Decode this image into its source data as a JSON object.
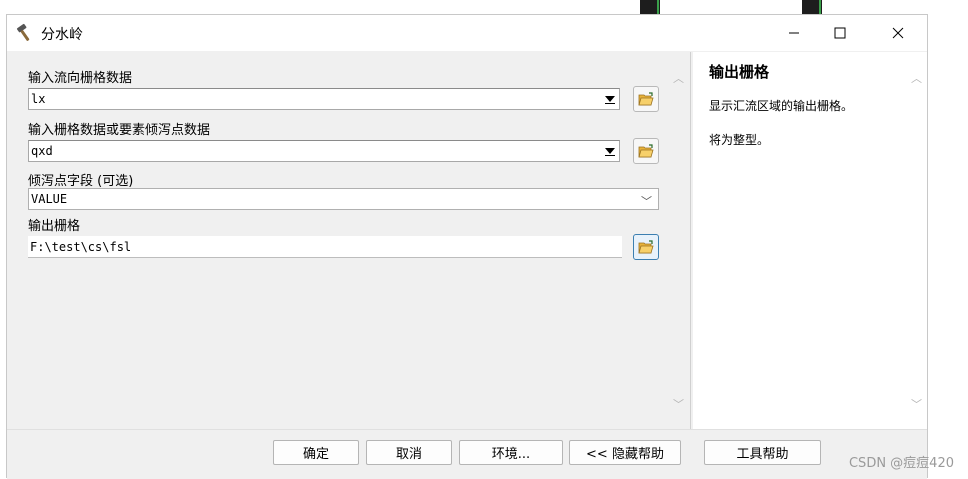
{
  "window": {
    "title": "分水岭"
  },
  "fields": [
    {
      "label": "输入流向栅格数据",
      "value": "lx"
    },
    {
      "label": "输入栅格数据或要素倾泻点数据",
      "value": "qxd"
    },
    {
      "label": "倾泻点字段 (可选)",
      "value": "VALUE"
    },
    {
      "label": "输出栅格",
      "value": "F:\\test\\cs\\fsl"
    }
  ],
  "help": {
    "title": "输出栅格",
    "desc": "显示汇流区域的输出栅格。",
    "note": "将为整型。"
  },
  "buttons": {
    "ok": "确定",
    "cancel": "取消",
    "env": "环境...",
    "hide_help": "<< 隐藏帮助",
    "tool_help": "工具帮助"
  },
  "watermark": "CSDN @痘痘420"
}
